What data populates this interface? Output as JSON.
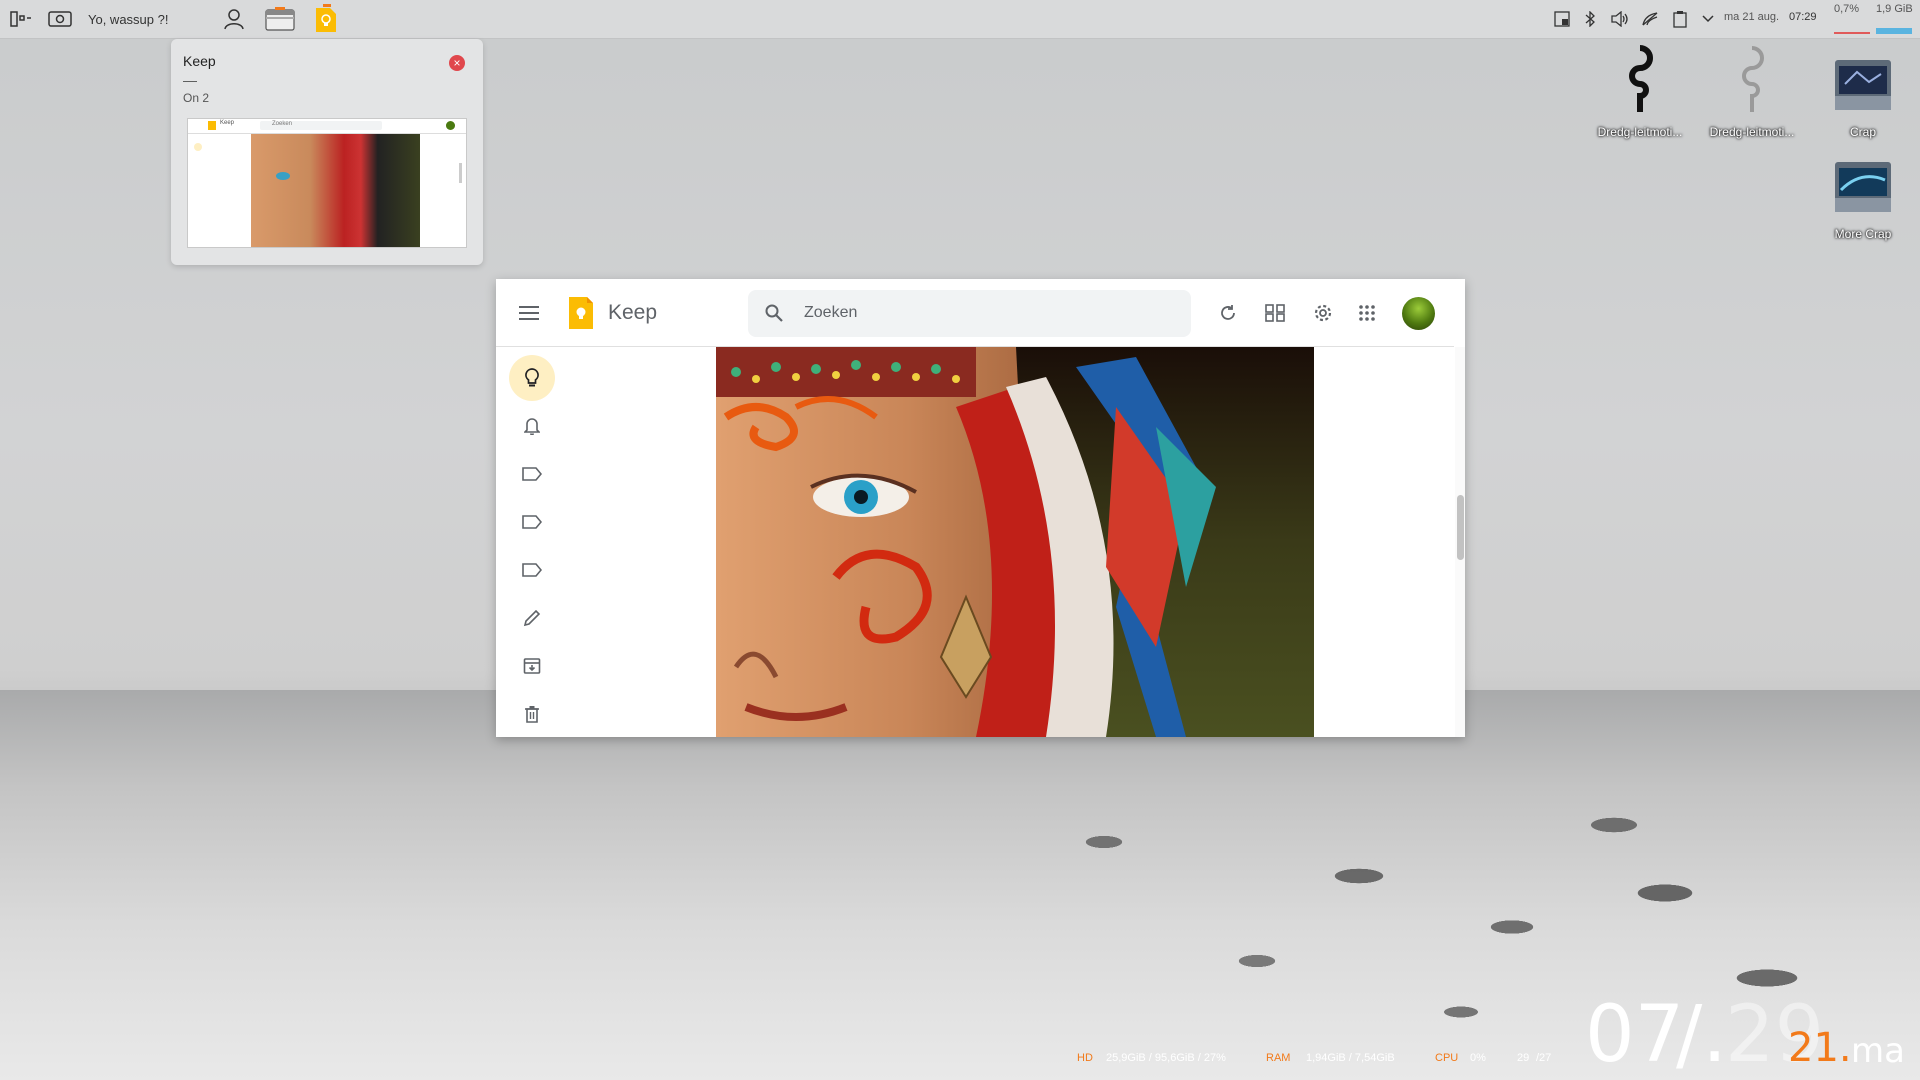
{
  "panel": {
    "widget_text": "Yo, wassup ?!",
    "tray": {
      "date": "ma 21 aug.",
      "time": "07:29",
      "cpu_percent": "0,7%",
      "mem": "1,9 GiB"
    }
  },
  "tooltip": {
    "title": "Keep",
    "dash": "—",
    "subtitle": "On 2",
    "thumb": {
      "app": "Keep",
      "search": "Zoeken"
    }
  },
  "keep": {
    "app_title": "Keep",
    "search_placeholder": "Zoeken",
    "sidebar_items": [
      "notes",
      "reminders",
      "label",
      "label",
      "label",
      "edit-labels",
      "archive",
      "trash"
    ]
  },
  "desktop_icons": [
    {
      "label": "Dredg-leitmoti..."
    },
    {
      "label": "Dredg-leitmoti..."
    },
    {
      "label": "Crap"
    },
    {
      "label": "More Crap"
    }
  ],
  "stats": {
    "hd_label": "HD",
    "hd_value": "25,9GiB / 95,6GiB / 27%",
    "ram_label": "RAM",
    "ram_value": "1,94GiB / 7,54GiB",
    "cpu_label": "CPU",
    "cpu_value": "0%",
    "temp_a": "29",
    "temp_b": "/27"
  },
  "clock": {
    "hour": "07",
    "separator": "/.",
    "minutes": "29",
    "day_num": "21.",
    "day_name": "ma"
  },
  "colors": {
    "keep_yellow": "#fbbc04",
    "accent_orange": "#f27a1a",
    "close_red": "#e0474c",
    "active_pill": "#feefc3"
  }
}
